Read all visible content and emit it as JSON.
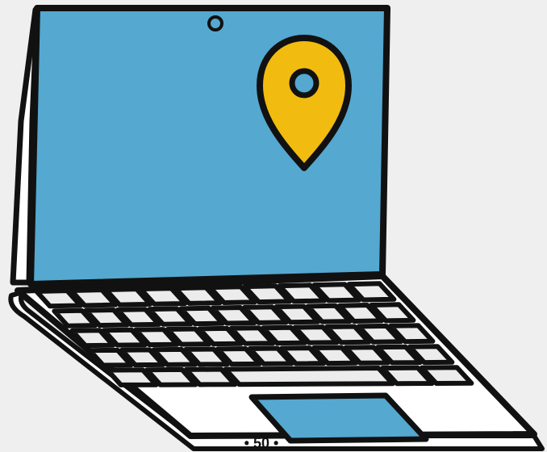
{
  "illustration": {
    "subject": "laptop-icon",
    "screen_icon": "location-pin-icon",
    "colors": {
      "background": "#efefef",
      "outline": "#111111",
      "screen": "#55a8d0",
      "pin": "#f2bb0f",
      "keys": "#ececec",
      "trackpad": "#55a8d0"
    }
  },
  "footer": {
    "page_number": "• 50 •"
  }
}
